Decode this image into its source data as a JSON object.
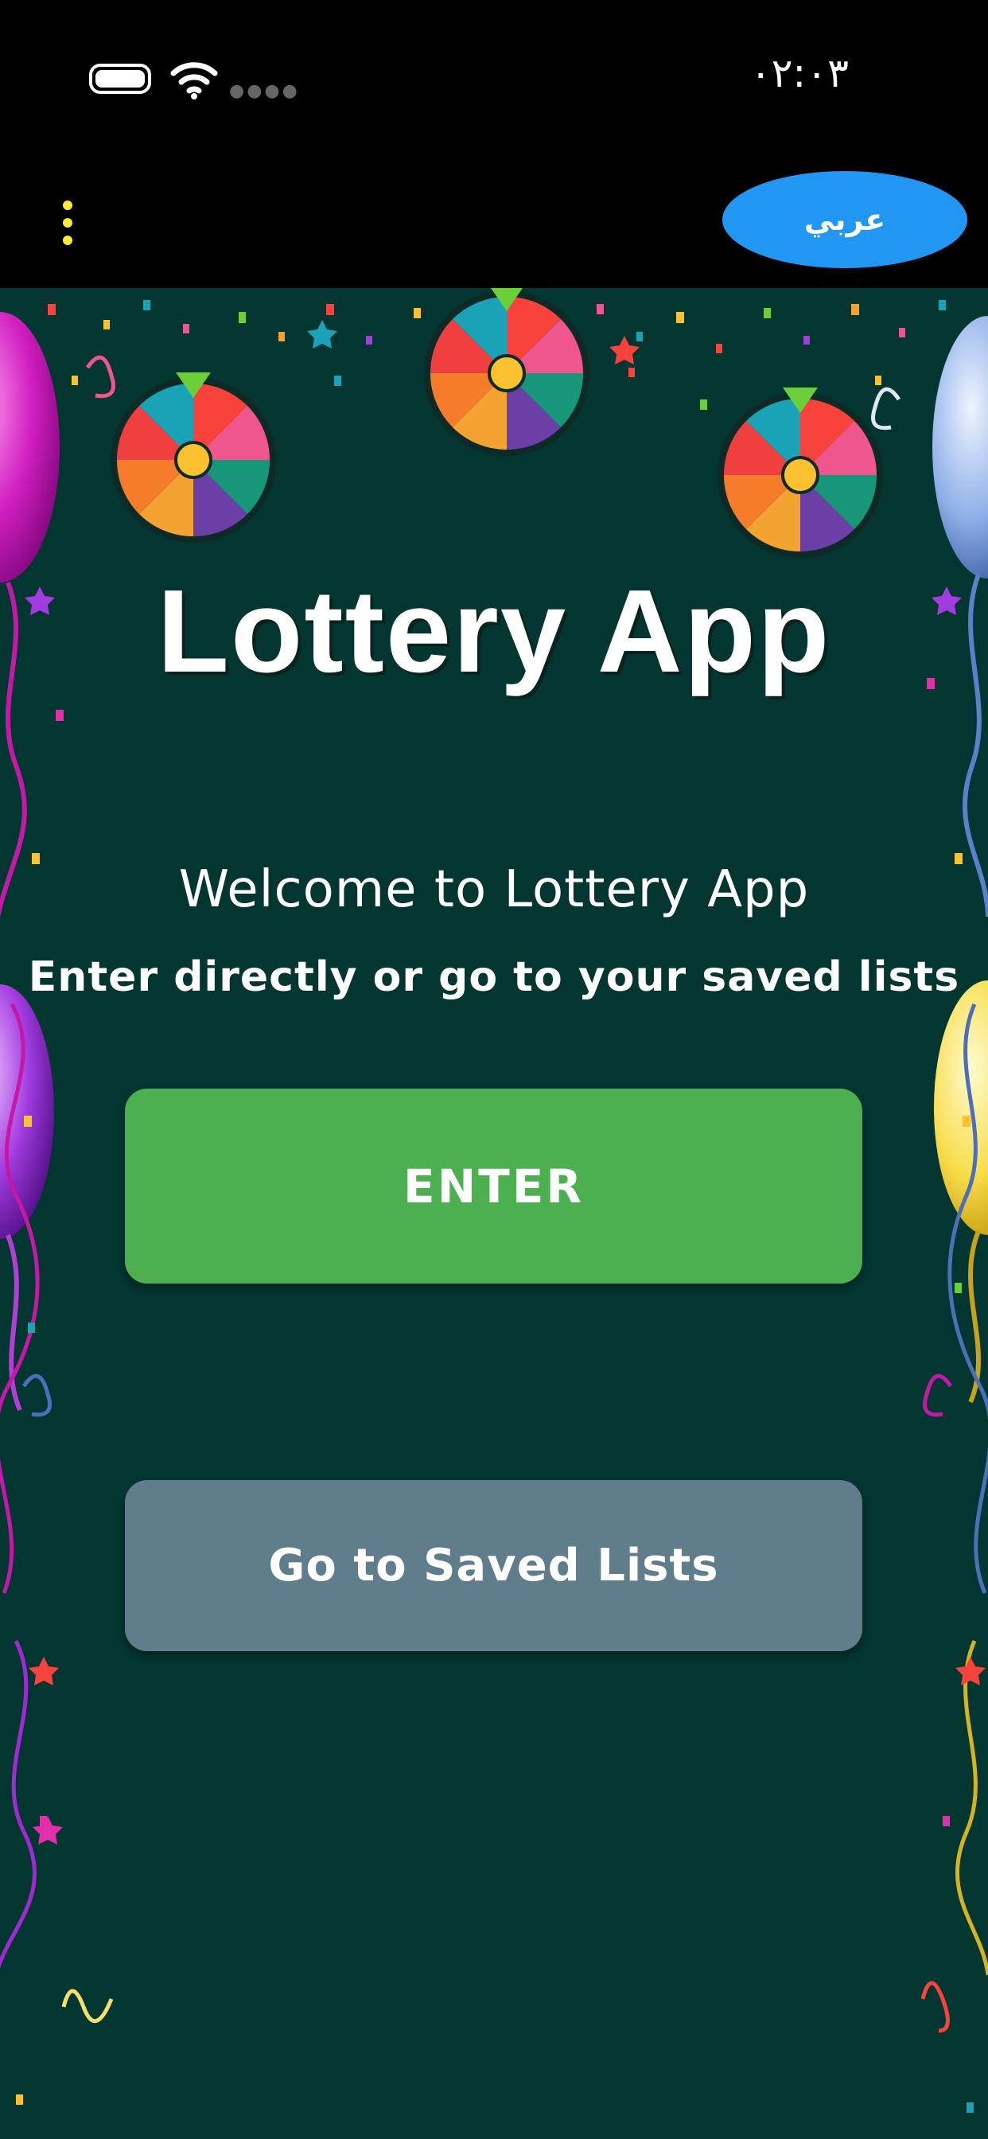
{
  "status_bar": {
    "time": "٠٢:٠٣"
  },
  "app_bar": {
    "language_button": "عربي"
  },
  "main": {
    "title": "Lottery App",
    "welcome": "Welcome to Lottery App",
    "subtitle": "Enter directly or go to your saved lists",
    "enter_button": "ENTER",
    "saved_button": "Go to Saved Lists"
  },
  "colors": {
    "background": "#043631",
    "enter_button": "#4CAF50",
    "saved_button": "#607D8B",
    "language_button": "#2196F3",
    "menu_dots": "#FFEB3B"
  }
}
